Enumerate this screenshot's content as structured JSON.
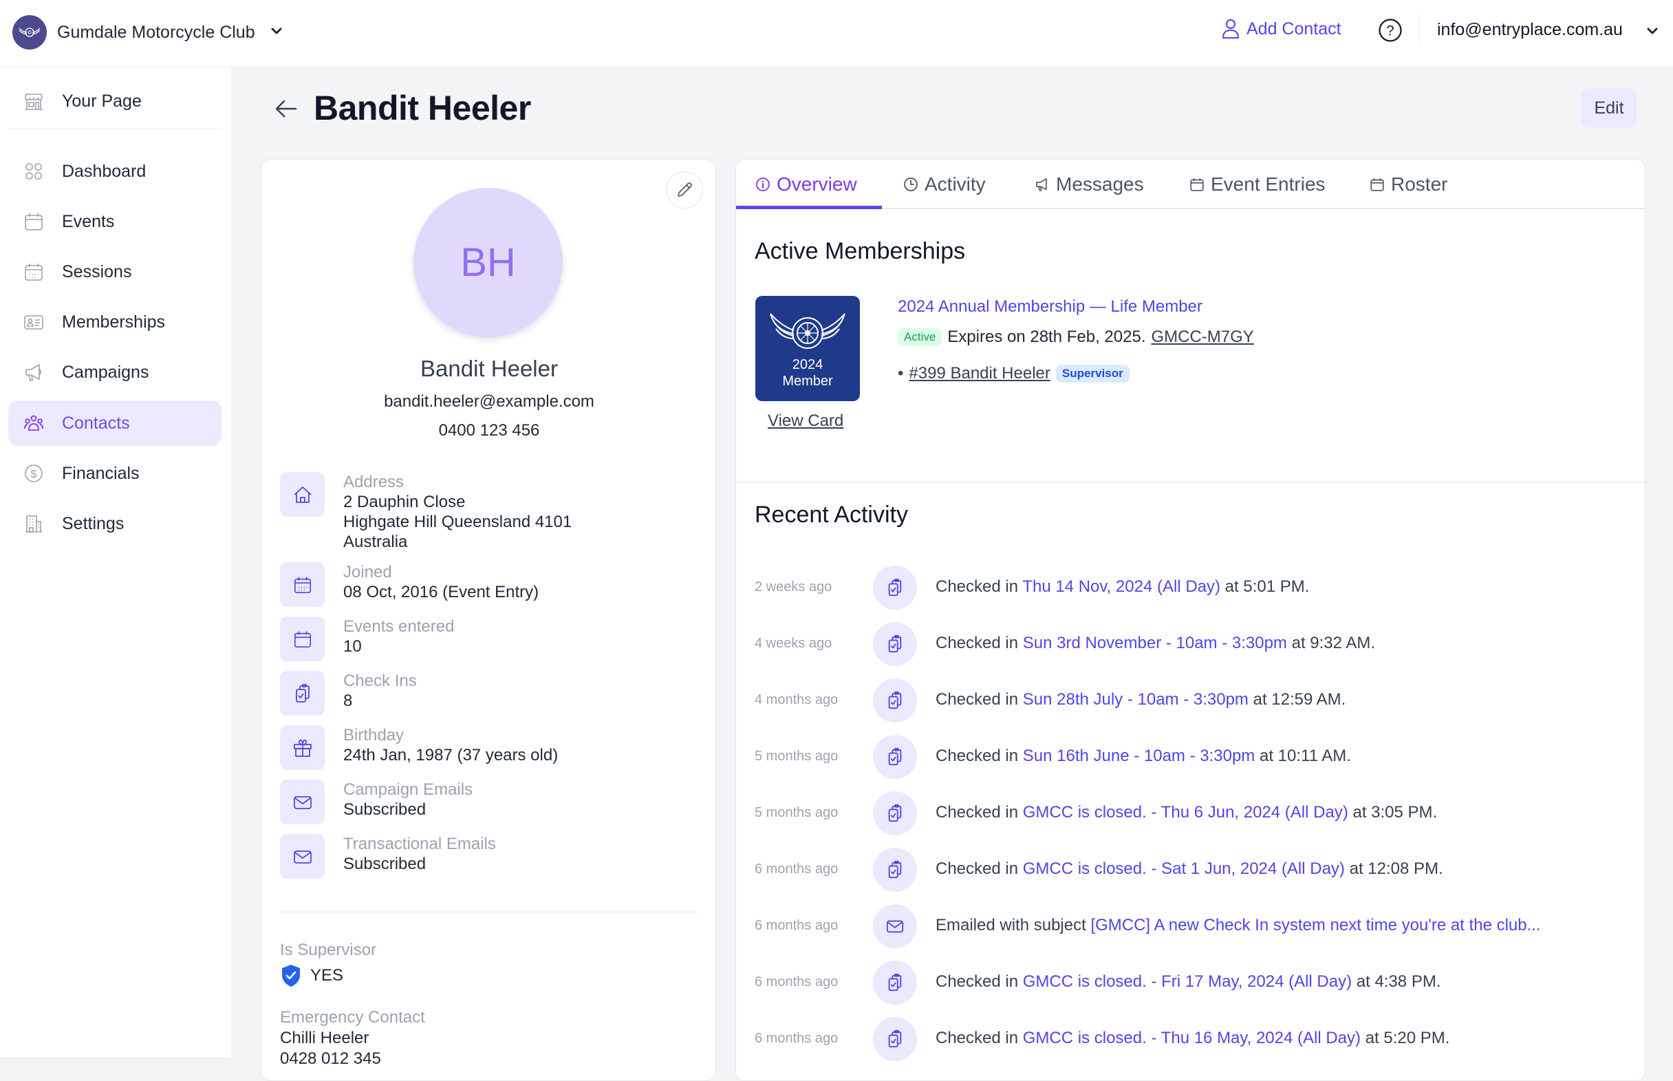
{
  "header": {
    "club_name": "Gumdale Motorcycle Club",
    "add_contact_label": "Add Contact",
    "account_email": "info@entryplace.com.au"
  },
  "sidebar": {
    "items": [
      {
        "label": "Your Page",
        "icon": "storefront-icon"
      },
      {
        "label": "Dashboard",
        "icon": "grid-icon"
      },
      {
        "label": "Events",
        "icon": "calendar-icon"
      },
      {
        "label": "Sessions",
        "icon": "calendar-days-icon"
      },
      {
        "label": "Memberships",
        "icon": "id-card-icon"
      },
      {
        "label": "Campaigns",
        "icon": "megaphone-icon"
      },
      {
        "label": "Contacts",
        "icon": "users-icon",
        "active": true
      },
      {
        "label": "Financials",
        "icon": "dollar-circle-icon"
      },
      {
        "label": "Settings",
        "icon": "building-icon"
      }
    ]
  },
  "page": {
    "title": "Bandit Heeler",
    "edit_label": "Edit"
  },
  "profile": {
    "initials": "BH",
    "name": "Bandit Heeler",
    "email": "bandit.heeler@example.com",
    "phone": "0400 123 456",
    "info": [
      {
        "label": "Address",
        "lines": [
          "2 Dauphin Close",
          "Highgate Hill Queensland 4101",
          "Australia"
        ],
        "icon": "home-icon"
      },
      {
        "label": "Joined",
        "lines": [
          "08 Oct, 2016 (Event Entry)"
        ],
        "icon": "calendar-days-icon"
      },
      {
        "label": "Events entered",
        "lines": [
          "10"
        ],
        "icon": "calendar-icon"
      },
      {
        "label": "Check Ins",
        "lines": [
          "8"
        ],
        "icon": "clipboard-check-icon"
      },
      {
        "label": "Birthday",
        "lines": [
          "24th Jan, 1987 (37 years old)"
        ],
        "icon": "gift-icon"
      },
      {
        "label": "Campaign Emails",
        "lines": [
          "Subscribed"
        ],
        "icon": "mail-icon"
      },
      {
        "label": "Transactional Emails",
        "lines": [
          "Subscribed"
        ],
        "icon": "mail-icon"
      }
    ],
    "is_supervisor_label": "Is Supervisor",
    "is_supervisor_value": "YES",
    "emergency_label": "Emergency Contact",
    "emergency_name": "Chilli Heeler",
    "emergency_phone": "0428 012 345"
  },
  "tabs": [
    {
      "label": "Overview",
      "icon": "info-icon",
      "active": true
    },
    {
      "label": "Activity",
      "icon": "clock-icon"
    },
    {
      "label": "Messages",
      "icon": "megaphone-icon"
    },
    {
      "label": "Event Entries",
      "icon": "calendar-icon"
    },
    {
      "label": "Roster",
      "icon": "calendar-icon"
    }
  ],
  "memberships": {
    "heading": "Active Memberships",
    "card_line1": "2024",
    "card_line2": "Member",
    "view_card_label": "View Card",
    "title": "2024 Annual Membership — Life Member",
    "status": "Active",
    "expires_text": "Expires on 28th Feb, 2025.",
    "code": "GMCC-M7GY",
    "member_link": "#399 Bandit Heeler",
    "member_role": "Supervisor"
  },
  "recent_activity": {
    "heading": "Recent Activity",
    "items": [
      {
        "time": "2 weeks ago",
        "type": "checkin",
        "prefix": "Checked in ",
        "link": "Thu 14 Nov, 2024 (All Day)",
        "suffix": " at 5:01 PM."
      },
      {
        "time": "4 weeks ago",
        "type": "checkin",
        "prefix": "Checked in ",
        "link": "Sun 3rd November - 10am - 3:30pm",
        "suffix": " at 9:32 AM."
      },
      {
        "time": "4 months ago",
        "type": "checkin",
        "prefix": "Checked in ",
        "link": "Sun 28th July - 10am - 3:30pm",
        "suffix": " at 12:59 AM."
      },
      {
        "time": "5 months ago",
        "type": "checkin",
        "prefix": "Checked in ",
        "link": "Sun 16th June - 10am - 3:30pm",
        "suffix": " at 10:11 AM."
      },
      {
        "time": "5 months ago",
        "type": "checkin",
        "prefix": "Checked in ",
        "link": "GMCC is closed. - Thu 6 Jun, 2024 (All Day)",
        "suffix": " at 3:05 PM."
      },
      {
        "time": "6 months ago",
        "type": "checkin",
        "prefix": "Checked in ",
        "link": "GMCC is closed. - Sat 1 Jun, 2024 (All Day)",
        "suffix": " at 12:08 PM."
      },
      {
        "time": "6 months ago",
        "type": "email",
        "prefix": "Emailed with subject ",
        "link": "[GMCC] A new Check In system next time you're at the club...",
        "suffix": ""
      },
      {
        "time": "6 months ago",
        "type": "checkin",
        "prefix": "Checked in ",
        "link": "GMCC is closed. - Fri 17 May, 2024 (All Day)",
        "suffix": " at 4:38 PM."
      },
      {
        "time": "6 months ago",
        "type": "checkin",
        "prefix": "Checked in ",
        "link": "GMCC is closed. - Thu 16 May, 2024 (All Day)",
        "suffix": " at 5:20 PM."
      }
    ]
  },
  "colors": {
    "accent": "#4f46e5",
    "accent_purple": "#7c3aed",
    "active_bg": "#ebe9fe",
    "card_blue": "#1f3a8a",
    "success": "#16a34a"
  }
}
